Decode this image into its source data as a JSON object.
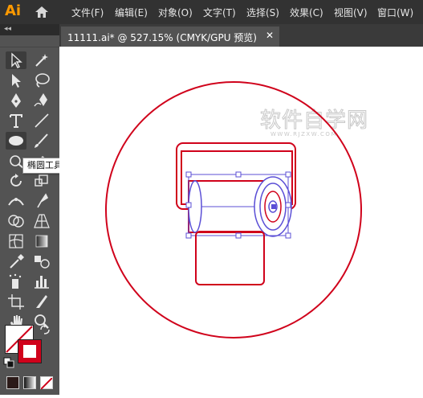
{
  "app": {
    "logo": "Ai"
  },
  "menu": [
    "文件(F)",
    "编辑(E)",
    "对象(O)",
    "文字(T)",
    "选择(S)",
    "效果(C)",
    "视图(V)",
    "窗口(W)"
  ],
  "panel_collapse": "◂◂",
  "document_tab": {
    "title": "11111.ai* @ 527.15% (CMYK/GPU 预览)",
    "close": "✕"
  },
  "tooltip": "椭圆工具 (L)",
  "watermark": {
    "main": "软件自学网",
    "sub": "WWW.RJZXW.COM"
  },
  "colors": {
    "stroke_art": "#d0021b",
    "selection": "#5b4fd6",
    "ui_dark": "#323232",
    "toolbar": "#535353"
  },
  "tools": [
    "selection-tool",
    "magic-wand-tool",
    "direct-selection-tool",
    "lasso-tool",
    "pen-tool",
    "curvature-tool",
    "type-tool",
    "line-tool",
    "ellipse-tool",
    "paintbrush-tool",
    "shaper-tool",
    "eraser-tool",
    "rotate-tool",
    "scale-tool",
    "width-tool",
    "free-transform-tool",
    "shape-builder-tool",
    "perspective-grid-tool",
    "mesh-tool",
    "gradient-tool",
    "eyedropper-tool",
    "blend-tool",
    "symbol-sprayer-tool",
    "column-graph-tool",
    "artboard-tool",
    "slice-tool",
    "hand-tool",
    "zoom-tool"
  ]
}
